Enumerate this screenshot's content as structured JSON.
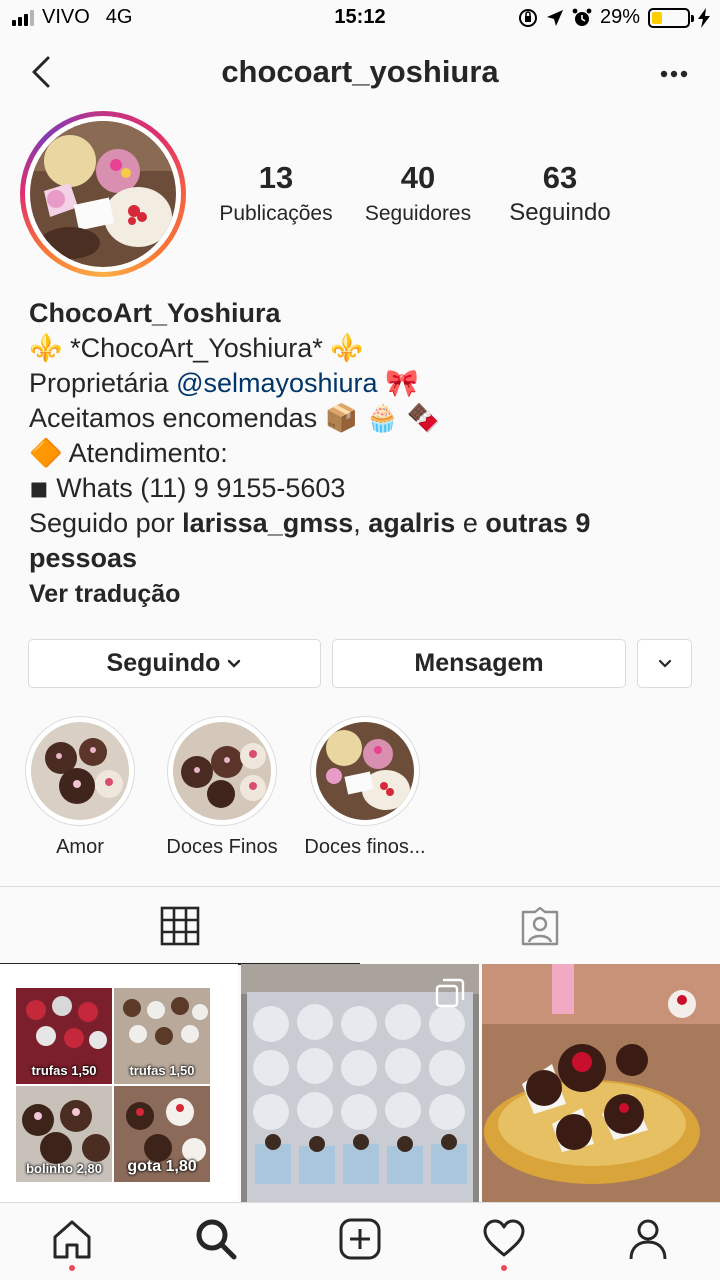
{
  "status_bar": {
    "carrier": "VIVO",
    "network": "4G",
    "time": "15:12",
    "battery_percent": "29%",
    "battery_level": 0.29,
    "battery_color": "#ffcc00"
  },
  "header": {
    "username": "chocoart_yoshiura",
    "back_icon": "chevron-left-icon",
    "more_icon": "more-horizontal-icon"
  },
  "stats": [
    {
      "value": "13",
      "label": "Publicações"
    },
    {
      "value": "40",
      "label": "Seguidores"
    },
    {
      "value": "63",
      "label": "Seguindo"
    }
  ],
  "bio": {
    "name": "ChocoArt_Yoshiura",
    "line1": "⚜️ *ChocoArt_Yoshiura* ⚜️",
    "owner_prefix": "Proprietária ",
    "owner_mention": "@selmayoshiura",
    "owner_suffix": " 🎀",
    "line3": "Aceitamos encomendas 📦 🧁 🍫",
    "line4": "🔶 Atendimento:",
    "line5": "◾ Whats (11) 9 9155-5603",
    "followed_prefix": "Seguido por ",
    "followed_user1": "larissa_gmss",
    "followed_sep": ", ",
    "followed_user2": "agalris",
    "followed_and": " e ",
    "followed_rest": "outras 9 pessoas",
    "translate": "Ver tradução"
  },
  "actions": {
    "following": "Seguindo",
    "message": "Mensagem"
  },
  "highlights": [
    {
      "label": "Amor"
    },
    {
      "label": "Doces Finos"
    },
    {
      "label": "Doces finos..."
    }
  ],
  "tabs": {
    "grid_icon": "grid-icon",
    "tagged_icon": "tagged-user-icon"
  },
  "posts": {
    "collage_labels": [
      "trufas 1,50",
      "trufas 1,50",
      "bolinho 2,80",
      "gota 1,80"
    ]
  },
  "bottom_nav": {
    "items": [
      "home-icon",
      "search-icon",
      "add-post-icon",
      "activity-heart-icon",
      "profile-icon"
    ]
  },
  "colors": {
    "accent_link": "#003569",
    "notification_dot": "#ed4956"
  }
}
